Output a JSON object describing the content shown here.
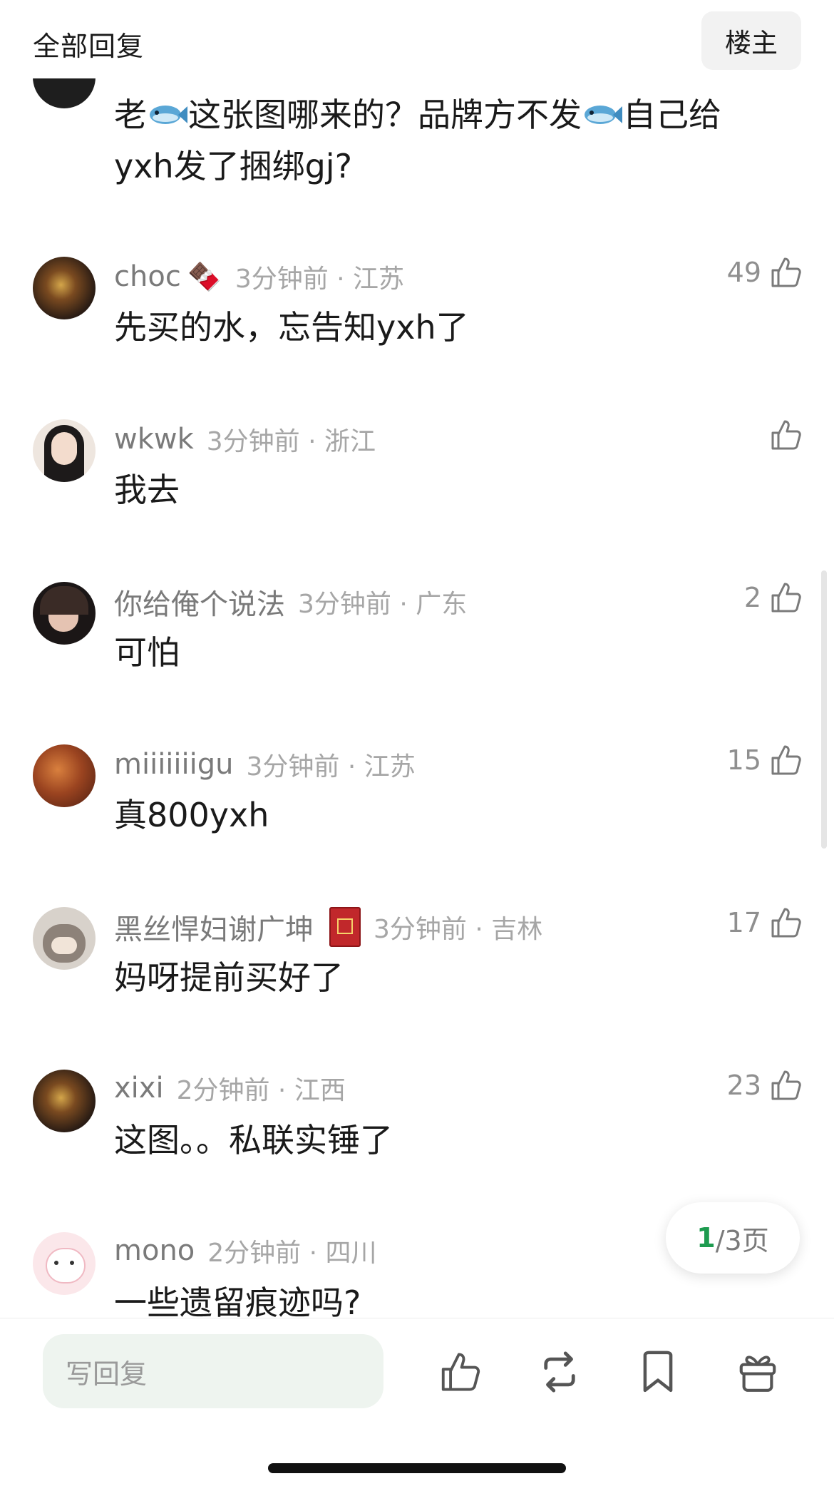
{
  "header": {
    "title": "全部回复",
    "owner_button": "楼主"
  },
  "partial_comment": {
    "line1_a": "老",
    "line1_b": "这张图哪来的？品牌方不发",
    "line1_c": "自己给",
    "line2": "yxh发了捆绑gj?",
    "icons": [
      "fish-emoji",
      "fish-emoji"
    ]
  },
  "comments": [
    {
      "user": "choc",
      "badge_icon": "chocolate-emoji",
      "badge": "🍫",
      "time": "3分钟前 · 江苏",
      "text": "先买的水，忘告知yxh了",
      "likes": "49",
      "avatar_color": "#3a2a1f"
    },
    {
      "user": "wkwk",
      "time": "3分钟前 · 浙江",
      "text": "我去",
      "likes": "",
      "avatar_color": "#e9dfd7"
    },
    {
      "user": "你给俺个说法",
      "time": "3分钟前 · 广东",
      "text": "可怕",
      "likes": "2",
      "avatar_color": "#2b2626"
    },
    {
      "user": "miiiiiiigu",
      "time": "3分钟前 · 江苏",
      "text": "真800yxh",
      "likes": "15",
      "avatar_color": "#a8512a"
    },
    {
      "user": "黑丝悍妇谢广坤",
      "badge_icon": "red-book-icon",
      "time": "3分钟前 · 吉林",
      "text": "妈呀提前买好了",
      "likes": "17",
      "avatar_color": "#b8aca0"
    },
    {
      "user": "xixi",
      "time": "2分钟前 · 江西",
      "text": "这图。。私联实锤了",
      "likes": "23",
      "avatar_color": "#3a2a1f"
    },
    {
      "user": "mono",
      "time": "2分钟前 · 四川",
      "text": "一些遗留痕迹吗?",
      "likes": "",
      "avatar_color": "#f7d6dc"
    }
  ],
  "pager": {
    "current": "1",
    "total": "/3页"
  },
  "bottom_bar": {
    "reply_placeholder": "写回复",
    "icons": [
      "like-icon",
      "repost-icon",
      "bookmark-icon",
      "gift-icon"
    ]
  },
  "colors": {
    "accent_green": "#1d9b4f",
    "meta_gray": "#8f8f8f",
    "input_bg": "#eef4ef"
  }
}
